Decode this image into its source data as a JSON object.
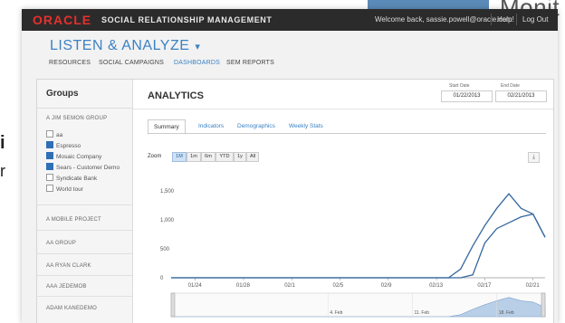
{
  "background": {
    "monitor_text": "Monit",
    "stray_text_1": "i",
    "stray_text_2": "r"
  },
  "topbar": {
    "logo": "ORACLE",
    "product": "SOCIAL RELATIONSHIP MANAGEMENT",
    "welcome": "Welcome back, sassie.powell@oracle.com!",
    "help": "Help",
    "logout": "Log Out"
  },
  "header": {
    "title": "LISTEN & ANALYZE",
    "tabs": [
      {
        "label": "RESOURCES",
        "active": false
      },
      {
        "label": "SOCIAL CAMPAIGNS",
        "active": false
      },
      {
        "label": "DASHBOARDS",
        "active": true
      },
      {
        "label": "SEM REPORTS",
        "active": false
      }
    ]
  },
  "sidebar": {
    "title": "Groups",
    "group_heading": "A JIM SEMON GROUP",
    "items": [
      {
        "label": "aa",
        "checked": false
      },
      {
        "label": "Espresso",
        "checked": true
      },
      {
        "label": "Mosaic Company",
        "checked": true
      },
      {
        "label": "Sears - Customer Demo",
        "checked": true
      },
      {
        "label": "Syndicate Bank",
        "checked": false
      },
      {
        "label": "World tour",
        "checked": false
      }
    ],
    "links": [
      "A MOBILE PROJECT",
      "AA GROUP",
      "AA RYAN CLARK",
      "AAA JEDEMOB",
      "ADAM KANEDEMO"
    ]
  },
  "main": {
    "title": "ANALYTICS",
    "start_date_label": "Start Date",
    "start_date": "01/22/2013",
    "end_date_label": "End Date",
    "end_date": "02/21/2013",
    "tabs": [
      {
        "label": "Summary",
        "active": true
      },
      {
        "label": "Indicators",
        "active": false
      },
      {
        "label": "Demographics",
        "active": false
      },
      {
        "label": "Weekly Stats",
        "active": false
      }
    ],
    "zoom_label": "Zoom",
    "zoom_buttons": [
      {
        "label": "1M",
        "active": true
      },
      {
        "label": "1m",
        "active": false
      },
      {
        "label": "6m",
        "active": false
      },
      {
        "label": "YTD",
        "active": false
      },
      {
        "label": "1y",
        "active": false
      },
      {
        "label": "All",
        "active": false
      }
    ],
    "export_icon": "download-icon"
  },
  "chart_data": {
    "type": "line",
    "title": "",
    "xlabel": "",
    "ylabel": "",
    "x_ticks": [
      "01/24",
      "01/28",
      "02/1",
      "02/5",
      "02/9",
      "02/13",
      "02/17",
      "02/21"
    ],
    "y_ticks": [
      0,
      500,
      1000,
      1500
    ],
    "ylim": [
      0,
      1500
    ],
    "grid": false,
    "navigator_labels": [
      "4. Feb",
      "11. Feb",
      "18. Feb"
    ],
    "series": [
      {
        "color": "#35689f",
        "x": [
          "01/22",
          "01/24",
          "01/28",
          "02/1",
          "02/5",
          "02/9",
          "02/13",
          "02/14",
          "02/15",
          "02/16",
          "02/17",
          "02/18",
          "02/19",
          "02/20",
          "02/21",
          "02/22"
        ],
        "values": [
          0,
          0,
          0,
          0,
          0,
          0,
          0,
          0,
          150,
          550,
          900,
          1200,
          1450,
          1200,
          1100,
          700
        ]
      },
      {
        "color": "#35689f",
        "x": [
          "01/22",
          "01/24",
          "01/28",
          "02/1",
          "02/5",
          "02/9",
          "02/13",
          "02/14",
          "02/15",
          "02/16",
          "02/17",
          "02/18",
          "02/19",
          "02/20",
          "02/21",
          "02/22"
        ],
        "values": [
          0,
          0,
          0,
          0,
          0,
          0,
          0,
          0,
          0,
          50,
          600,
          850,
          950,
          1050,
          1100,
          700
        ]
      }
    ]
  }
}
